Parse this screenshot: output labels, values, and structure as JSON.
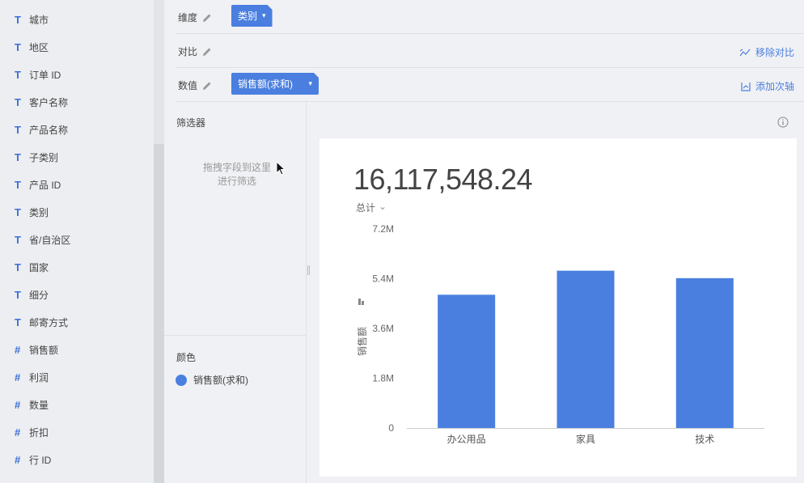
{
  "field_list": [
    {
      "type": "T",
      "label": "城市"
    },
    {
      "type": "T",
      "label": "地区"
    },
    {
      "type": "T",
      "label": "订单 ID"
    },
    {
      "type": "T",
      "label": "客户名称"
    },
    {
      "type": "T",
      "label": "产品名称"
    },
    {
      "type": "T",
      "label": "子类别"
    },
    {
      "type": "T",
      "label": "产品 ID"
    },
    {
      "type": "T",
      "label": "类别"
    },
    {
      "type": "T",
      "label": "省/自治区"
    },
    {
      "type": "T",
      "label": "国家"
    },
    {
      "type": "T",
      "label": "细分"
    },
    {
      "type": "T",
      "label": "邮寄方式"
    },
    {
      "type": "#",
      "label": "销售额"
    },
    {
      "type": "#",
      "label": "利润"
    },
    {
      "type": "#",
      "label": "数量"
    },
    {
      "type": "#",
      "label": "折扣"
    },
    {
      "type": "#",
      "label": "行 ID"
    }
  ],
  "config": {
    "dimension_label": "维度",
    "dimension_pill": "类别",
    "compare_label": "对比",
    "remove_compare": "移除对比",
    "value_label": "数值",
    "value_pill": "销售额(求和)",
    "add_secondary_axis": "添加次轴"
  },
  "filters": {
    "title": "筛选器",
    "hint_line1": "拖拽字段到这里",
    "hint_line2": "进行筛选"
  },
  "color": {
    "title": "颜色",
    "item_label": "销售额(求和)",
    "item_color": "#4a7fe0"
  },
  "summary": {
    "big_number": "16,117,548.24",
    "total_label": "总计"
  },
  "chart_data": {
    "type": "bar",
    "categories": [
      "办公用品",
      "家具",
      "技术"
    ],
    "series": [
      {
        "values": [
          4820000,
          5690000,
          5420000
        ],
        "color": "#4a7fe0"
      }
    ],
    "ylabel": "销售额",
    "ylim": [
      0,
      7200000
    ],
    "yticks": [
      0,
      1800000,
      3600000,
      5400000,
      7200000
    ],
    "ytick_labels": [
      "0",
      "1.8M",
      "3.6M",
      "5.4M",
      "7.2M"
    ],
    "grid": false
  }
}
